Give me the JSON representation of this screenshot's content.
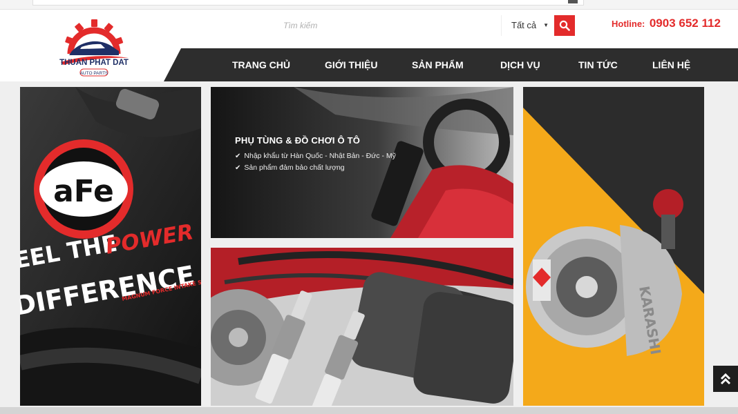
{
  "brand": {
    "name": "THUAN PHAT DAT",
    "tagline": "AUTO PARTS",
    "colors": {
      "accent": "#e32b2b",
      "dark": "#2d2d2d",
      "navy": "#1f2f66"
    }
  },
  "search": {
    "placeholder": "Tìm kiếm",
    "value": "",
    "category_selected": "Tất cả",
    "button_icon": "search-icon"
  },
  "hotline": {
    "label": "Hotline:",
    "number": "0903 652 112"
  },
  "nav": {
    "items": [
      {
        "label": "TRANG CHỦ"
      },
      {
        "label": "GIỚI THIỆU"
      },
      {
        "label": "SẢN PHẨM"
      },
      {
        "label": "DỊCH VỤ"
      },
      {
        "label": "TIN TỨC"
      },
      {
        "label": "LIÊN HỆ"
      }
    ]
  },
  "banners": {
    "left": {
      "logo_text": "aFe",
      "line1": "EEL THE",
      "line2": "POWER",
      "line3": "DIFFERENCE",
      "line4": "MAGNUM FORCE INTAKE SYST"
    },
    "mid_top": {
      "title": "PHỤ TÙNG & ĐỒ CHƠI Ô TÔ",
      "items": [
        "Nhập khẩu từ Hàn Quốc - Nhật Bản - Đức - Mỹ",
        "Sản phẩm đảm bảo chất lượng"
      ]
    },
    "right": {
      "product_text": "KARASHI"
    }
  },
  "scroll_top_icon": "double-chevron-up-icon"
}
